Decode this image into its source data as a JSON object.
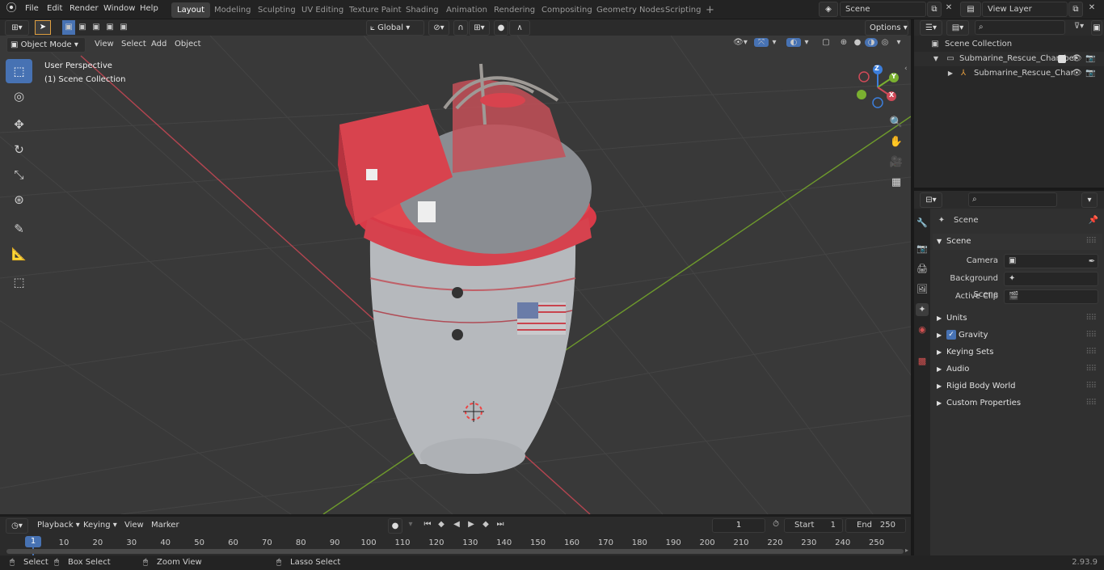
{
  "topbar": {
    "menus": [
      "File",
      "Edit",
      "Render",
      "Window",
      "Help"
    ],
    "workspaces": [
      "Layout",
      "Modeling",
      "Sculpting",
      "UV Editing",
      "Texture Paint",
      "Shading",
      "Animation",
      "Rendering",
      "Compositing",
      "Geometry Nodes",
      "Scripting"
    ],
    "active_workspace": "Layout",
    "add_tab": "+",
    "scene_name": "Scene",
    "view_layer": "View Layer"
  },
  "viewport_header": {
    "mode": "Object Mode",
    "menus": [
      "View",
      "Select",
      "Add",
      "Object"
    ],
    "orientation": "Global",
    "options": "Options"
  },
  "viewport": {
    "overlay_line1": "User Perspective",
    "overlay_line2": "(1) Scene Collection",
    "axes": {
      "x": "X",
      "y": "Y",
      "z": "Z"
    },
    "colors": {
      "x_axis": "#d04a58",
      "y_axis": "#7ab030",
      "z_axis": "#3c7edb",
      "chamber_red": "#d6424e",
      "chamber_grey": "#b5b8bc"
    }
  },
  "outliner": {
    "root": "Scene Collection",
    "collection": "Submarine_Rescue_Chamber",
    "object": "Submarine_Rescue_Char"
  },
  "properties": {
    "header": "Scene",
    "panel": "Scene",
    "fields": [
      {
        "label": "Camera",
        "value": ""
      },
      {
        "label": "Background Scene",
        "value": ""
      },
      {
        "label": "Active Clip",
        "value": ""
      }
    ],
    "subpanels": [
      "Units",
      "Gravity",
      "Keying Sets",
      "Audio",
      "Rigid Body World",
      "Custom Properties"
    ],
    "gravity_checked": true
  },
  "timeline": {
    "menus": [
      "Playback",
      "Keying",
      "View",
      "Marker"
    ],
    "current_frame": "1",
    "start_label": "Start",
    "start": "1",
    "end_label": "End",
    "end": "250",
    "ticks": [
      "10",
      "20",
      "30",
      "40",
      "50",
      "60",
      "70",
      "80",
      "90",
      "100",
      "110",
      "120",
      "130",
      "140",
      "150",
      "160",
      "170",
      "180",
      "190",
      "200",
      "210",
      "220",
      "230",
      "240",
      "250"
    ],
    "playhead": "1"
  },
  "statusbar": {
    "select": "Select",
    "box_select": "Box Select",
    "zoom_view": "Zoom View",
    "lasso_select": "Lasso Select",
    "version": "2.93.9"
  }
}
